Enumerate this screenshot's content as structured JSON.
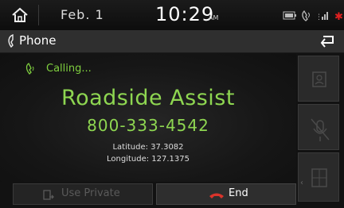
{
  "status_bar": {
    "date": "Feb.  1",
    "time": "10:29",
    "ampm": "AM"
  },
  "title_bar": {
    "title": "Phone"
  },
  "call": {
    "status": "Calling...",
    "contact_name": "Roadside Assist",
    "number": "800-333-4542",
    "latitude": "Latitude: 37.3082",
    "longitude": "Longitude: 127.1375"
  },
  "buttons": {
    "use_private": "Use Private",
    "end": "End"
  },
  "colors": {
    "accent_green": "#8ed651",
    "end_red": "#d9342b",
    "background": "#121212"
  }
}
